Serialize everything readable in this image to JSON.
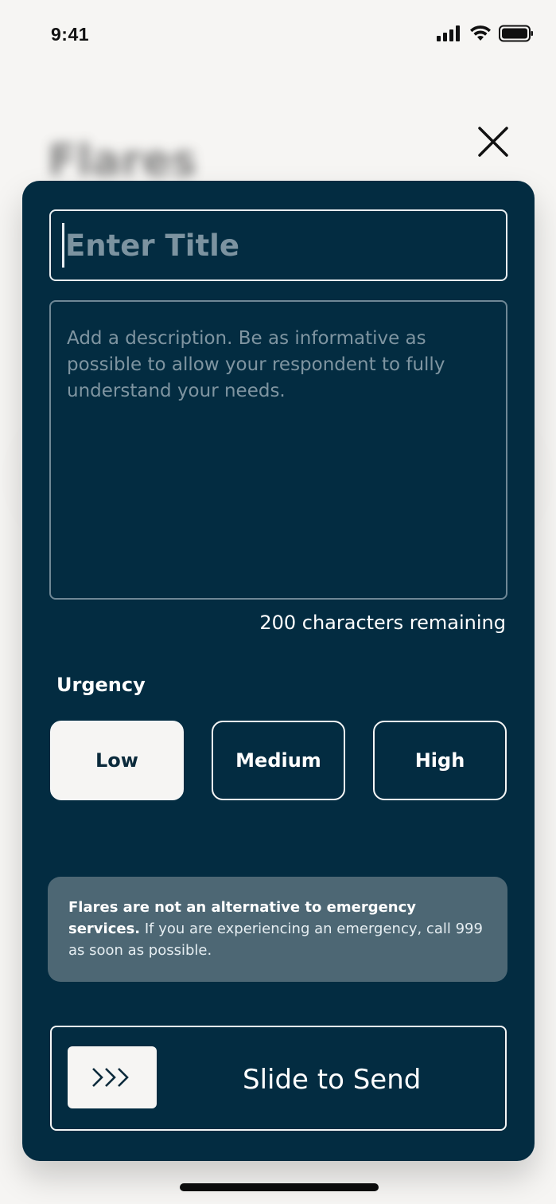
{
  "status_bar": {
    "time": "9:41",
    "icons": [
      "signal-icon",
      "wifi-icon",
      "battery-icon"
    ]
  },
  "background": {
    "title": "Flares"
  },
  "sheet": {
    "close_icon": "close-icon",
    "title_field": {
      "placeholder": "Enter Title",
      "value": ""
    },
    "description_field": {
      "placeholder": "Add a description. Be as informative as possible to allow your respondent to fully understand your needs.",
      "value": ""
    },
    "char_remaining": "200 characters remaining",
    "urgency": {
      "label": "Urgency",
      "options": [
        "Low",
        "Medium",
        "High"
      ],
      "selected": "Low"
    },
    "notice": {
      "bold": "Flares are not an alternative to emergency services.",
      "text": " If you are experiencing an emergency, call 999 as soon as possible."
    },
    "slider": {
      "label": "Slide to Send",
      "handle_icon": "triple-chevron-right-icon"
    }
  },
  "colors": {
    "sheet_bg": "#032c41",
    "page_bg": "#f6f5f3",
    "notice_bg": "#4d6774"
  }
}
